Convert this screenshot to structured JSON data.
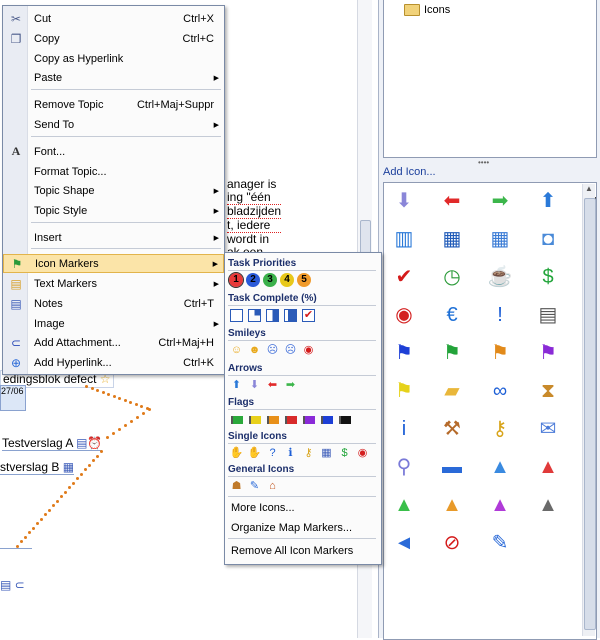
{
  "right_pane": {
    "tree_node_label": "Icons",
    "add_icon_link": "Add Icon...",
    "gallery_icons": [
      {
        "name": "arrow-down-icon",
        "glyph": "⬇",
        "color": "#8a86d8"
      },
      {
        "name": "arrow-left-icon",
        "glyph": "⬅",
        "color": "#e12a2a"
      },
      {
        "name": "arrow-right-icon",
        "glyph": "➡",
        "color": "#3cb64b"
      },
      {
        "name": "arrow-up-icon",
        "glyph": "⬆",
        "color": "#2a79d8"
      },
      {
        "name": "bomb-icon",
        "glyph": "●",
        "color": "#333"
      },
      {
        "name": "book-icon",
        "glyph": "▥",
        "color": "#2a79d8"
      },
      {
        "name": "map-icon",
        "glyph": "▦",
        "color": "#1f5ab8"
      },
      {
        "name": "calendar-icon",
        "glyph": "▦",
        "color": "#3a7bd5"
      },
      {
        "name": "camera-icon",
        "glyph": "◘",
        "color": "#4a8ad8"
      },
      {
        "name": "phone-icon",
        "glyph": "▮",
        "color": "#d23"
      },
      {
        "name": "checkmark-icon",
        "glyph": "✔",
        "color": "#d41a1a"
      },
      {
        "name": "clock-icon",
        "glyph": "◷",
        "color": "#2c9b3a"
      },
      {
        "name": "coffee-icon",
        "glyph": "☕",
        "color": "#b3520f"
      },
      {
        "name": "dollar-icon",
        "glyph": "$",
        "color": "#22a53a"
      },
      {
        "name": "at-icon",
        "glyph": "@",
        "color": "#1d6fd6"
      },
      {
        "name": "target-icon",
        "glyph": "◉",
        "color": "#d42020"
      },
      {
        "name": "euro-icon",
        "glyph": "€",
        "color": "#1d6fd6"
      },
      {
        "name": "exclamation-icon",
        "glyph": "!",
        "color": "#1d5fd6"
      },
      {
        "name": "fax-icon",
        "glyph": "▤",
        "color": "#555"
      },
      {
        "name": "flag-black-icon",
        "glyph": "⚑",
        "color": "#111"
      },
      {
        "name": "flag-blue-icon",
        "glyph": "⚑",
        "color": "#1d3fd6"
      },
      {
        "name": "flag-green-icon",
        "glyph": "⚑",
        "color": "#23a33a"
      },
      {
        "name": "flag-orange-icon",
        "glyph": "⚑",
        "color": "#e28a1a"
      },
      {
        "name": "flag-purple-icon",
        "glyph": "⚑",
        "color": "#8a2ad6"
      },
      {
        "name": "flag-red-icon",
        "glyph": "⚑",
        "color": "#d41a1a"
      },
      {
        "name": "flag-yellow-icon",
        "glyph": "⚑",
        "color": "#e6d21a"
      },
      {
        "name": "folder-open-icon",
        "glyph": "▰",
        "color": "#e9b73a"
      },
      {
        "name": "glasses-icon",
        "glyph": "∞",
        "color": "#1d5fd6"
      },
      {
        "name": "hourglass-icon",
        "glyph": "⧗",
        "color": "#c98a2a"
      },
      {
        "name": "house-icon",
        "glyph": "⌂",
        "color": "#c0521a"
      },
      {
        "name": "info-icon",
        "glyph": "i",
        "color": "#1d5fd6"
      },
      {
        "name": "judge-hammer-icon",
        "glyph": "⚒",
        "color": "#b56a2a"
      },
      {
        "name": "key-icon",
        "glyph": "⚷",
        "color": "#d8a41a"
      },
      {
        "name": "mail-icon",
        "glyph": "✉",
        "color": "#4a7ad8"
      },
      {
        "name": "lightbulb-icon",
        "glyph": "●",
        "color": "#f0d22a"
      },
      {
        "name": "magnifier-icon",
        "glyph": "⚲",
        "color": "#7a7ad8"
      },
      {
        "name": "mailbox-icon",
        "glyph": "▬",
        "color": "#2a6ad8"
      },
      {
        "name": "triangle-blue-icon",
        "glyph": "▲",
        "color": "#3a8ae0"
      },
      {
        "name": "triangle-red-icon",
        "glyph": "▲",
        "color": "#e03a3a"
      },
      {
        "name": "triangle-yellow-icon",
        "glyph": "▲",
        "color": "#e8d01a"
      },
      {
        "name": "triangle-green-icon",
        "glyph": "▲",
        "color": "#3abf4a"
      },
      {
        "name": "triangle-orange-icon",
        "glyph": "▲",
        "color": "#e89a2a"
      },
      {
        "name": "triangle-purple-icon",
        "glyph": "▲",
        "color": "#b03ad8"
      },
      {
        "name": "triangle-gray-icon",
        "glyph": "▲",
        "color": "#6a6a6a"
      },
      {
        "name": "handshake-icon",
        "glyph": "✋",
        "color": "#d8a46a"
      },
      {
        "name": "megaphone-icon",
        "glyph": "◄",
        "color": "#2a6ad8"
      },
      {
        "name": "no-entry-icon",
        "glyph": "⊘",
        "color": "#d41a1a"
      },
      {
        "name": "note-edit-icon",
        "glyph": "✎",
        "color": "#2a6ad8"
      }
    ]
  },
  "background": {
    "text_lines": [
      "anager is",
      "ing \"één",
      "bladzijden",
      "t, iedere",
      "wordt in",
      "ak een"
    ],
    "topic_defect": "edingsblok defect",
    "date": "27/06",
    "verslag_a": "Testverslag A",
    "verslag_b": "stverslag B"
  },
  "context_menu": {
    "items": [
      {
        "label": "Cut",
        "shortcut": "Ctrl+X",
        "icon": "scissors-icon",
        "glyph": "✂",
        "color": "#4a5a8a"
      },
      {
        "label": "Copy",
        "shortcut": "Ctrl+C",
        "icon": "copy-icon",
        "glyph": "❐",
        "color": "#4a5a8a"
      },
      {
        "label": "Copy as Hyperlink",
        "shortcut": "",
        "icon": "",
        "glyph": "",
        "color": ""
      },
      {
        "label": "Paste",
        "shortcut": "",
        "icon": "",
        "glyph": "",
        "color": ""
      },
      {
        "label": "Remove Topic",
        "shortcut": "Ctrl+Maj+Suppr",
        "icon": "",
        "glyph": "",
        "color": ""
      },
      {
        "label": "Send To",
        "shortcut": "",
        "icon": "",
        "glyph": "",
        "color": ""
      },
      {
        "label": "Font...",
        "shortcut": "",
        "icon": "font-icon",
        "glyph": "A",
        "color": "#333"
      },
      {
        "label": "Format Topic...",
        "shortcut": "",
        "icon": "",
        "glyph": "",
        "color": ""
      },
      {
        "label": "Topic Shape",
        "shortcut": "",
        "icon": "",
        "glyph": "",
        "color": ""
      },
      {
        "label": "Topic Style",
        "shortcut": "",
        "icon": "",
        "glyph": "",
        "color": ""
      },
      {
        "label": "Insert",
        "shortcut": "",
        "icon": "",
        "glyph": "",
        "color": ""
      },
      {
        "label": "Icon Markers",
        "shortcut": "",
        "icon": "icon-markers-icon",
        "glyph": "⚑",
        "color": "#2a9a3a"
      },
      {
        "label": "Text Markers",
        "shortcut": "",
        "icon": "text-markers-icon",
        "glyph": "▤",
        "color": "#d8a02a"
      },
      {
        "label": "Notes",
        "shortcut": "Ctrl+T",
        "icon": "notes-icon",
        "glyph": "▤",
        "color": "#3a5ab8"
      },
      {
        "label": "Image",
        "shortcut": "",
        "icon": "",
        "glyph": "",
        "color": ""
      },
      {
        "label": "Add Attachment...",
        "shortcut": "Ctrl+Maj+H",
        "icon": "paperclip-icon",
        "glyph": "⊂",
        "color": "#2a4ab8"
      },
      {
        "label": "Add Hyperlink...",
        "shortcut": "Ctrl+K",
        "icon": "hyperlink-icon",
        "glyph": "⊕",
        "color": "#2a6ad8"
      }
    ]
  },
  "submenu": {
    "task_priorities_title": "Task Priorities",
    "priorities": [
      {
        "n": "1",
        "color": "#e83a3a"
      },
      {
        "n": "2",
        "color": "#2a5ad8"
      },
      {
        "n": "3",
        "color": "#3ab04a"
      },
      {
        "n": "4",
        "color": "#e8c81a"
      },
      {
        "n": "5",
        "color": "#f09a2a"
      }
    ],
    "task_complete_title": "Task Complete (%)",
    "smileys_title": "Smileys",
    "arrows_title": "Arrows",
    "flags_title": "Flags",
    "flag_colors": [
      "#2aa83a",
      "#e8d01a",
      "#e8901a",
      "#d82a2a",
      "#8a2ad8",
      "#1d3fd6",
      "#111111"
    ],
    "single_icons_title": "Single Icons",
    "general_icons_title": "General Icons",
    "more_icons": "More Icons...",
    "organize": "Organize Map Markers...",
    "remove_all": "Remove All Icon Markers"
  }
}
